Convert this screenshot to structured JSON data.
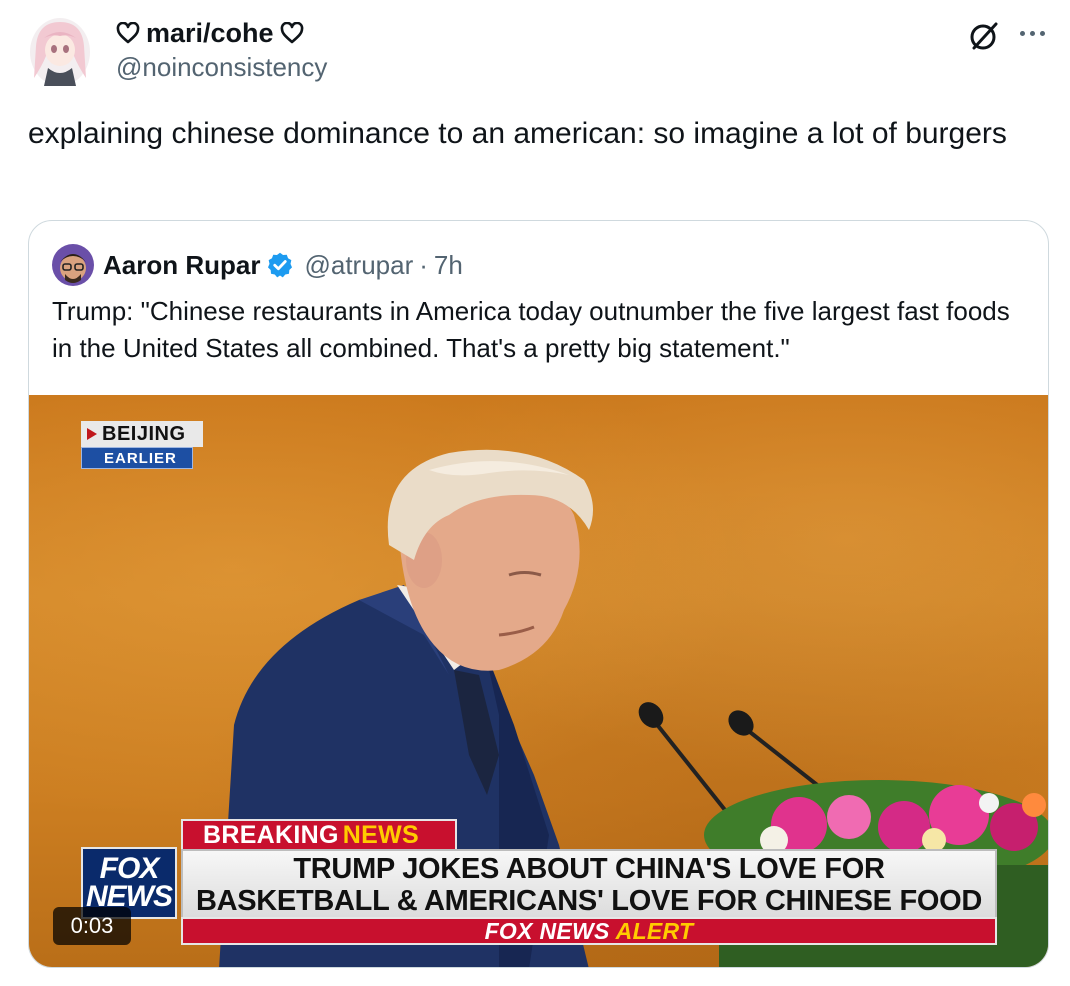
{
  "tweet": {
    "display_name": "mari/cohe",
    "handle": "@noinconsistency",
    "text": "explaining chinese dominance to an american: so imagine a lot of burgers"
  },
  "quoted_tweet": {
    "display_name": "Aaron Rupar",
    "handle": "@atrupar",
    "separator": "·",
    "time": "7h",
    "text": "Trump: \"Chinese restaurants in America today outnumber the five largest fast foods in the United States all combined. That's a pretty big statement.\"",
    "video": {
      "location_tag": "BEIJING",
      "location_sub": "EARLIER",
      "breaking_label_1": "BREAKING",
      "breaking_label_2": "NEWS",
      "headline_line1": "TRUMP JOKES ABOUT CHINA'S LOVE FOR",
      "headline_line2": "BASKETBALL & AMERICANS' LOVE FOR CHINESE FOOD",
      "alert_1": "FOX NEWS",
      "alert_2": "ALERT",
      "logo_line1": "FOX",
      "logo_line2": "NEWS",
      "duration": "0:03"
    }
  },
  "colors": {
    "text_primary": "#0f1419",
    "text_secondary": "#536471",
    "verified_blue": "#1d9bf0",
    "border": "#cfd9de",
    "fox_red": "#c8102e"
  },
  "icons": [
    "heart-outline-icon",
    "grok-icon",
    "more-icon",
    "verified-badge-icon"
  ]
}
